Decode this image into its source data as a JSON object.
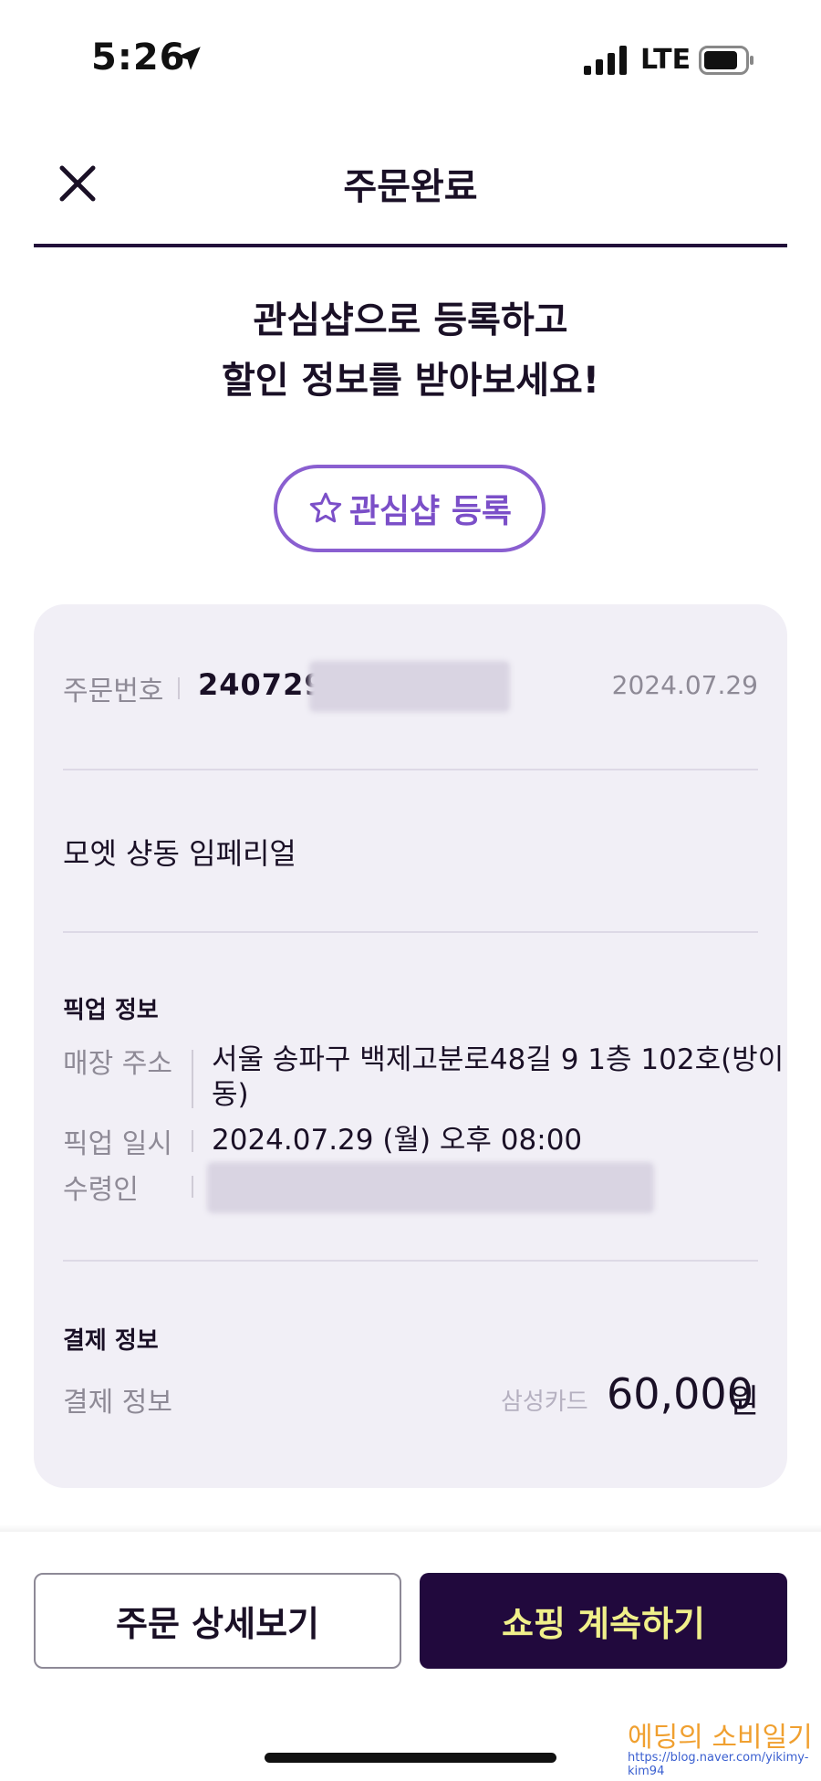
{
  "status_bar": {
    "time": "5:26",
    "network": "LTE"
  },
  "header": {
    "title": "주문완료"
  },
  "promo": {
    "line1": "관심샵으로 등록하고",
    "line2": "할인 정보를 받아보세요!",
    "favorite_button": "관심샵 등록"
  },
  "order": {
    "number_label": "주문번호",
    "number_visible": "240729",
    "date": "2024.07.29",
    "shop_name": "모엣 샹동 임페리얼"
  },
  "pickup": {
    "section_title": "픽업 정보",
    "address_label": "매장 주소",
    "address_line1": "서울 송파구 백제고분로48길 9 1층 102호(방이",
    "address_line2": "동)",
    "datetime_label": "픽업 일시",
    "datetime": "2024.07.29 (월) 오후 08:00",
    "recipient_label": "수령인"
  },
  "payment": {
    "section_title": "결제 정보",
    "label": "결제 정보",
    "method": "삼성카드",
    "amount": "60,000",
    "unit": "원"
  },
  "actions": {
    "detail_button": "주문 상세보기",
    "continue_button": "쇼핑 계속하기"
  },
  "watermark": {
    "text": "에딩의 소비일기",
    "url": "https://blog.naver.com/yikimy-kim94"
  },
  "colors": {
    "accent_purple": "#8a5fd0",
    "primary_dark": "#21093d",
    "button_text_yellow": "#f0f08a",
    "card_bg": "#f1eff6"
  }
}
